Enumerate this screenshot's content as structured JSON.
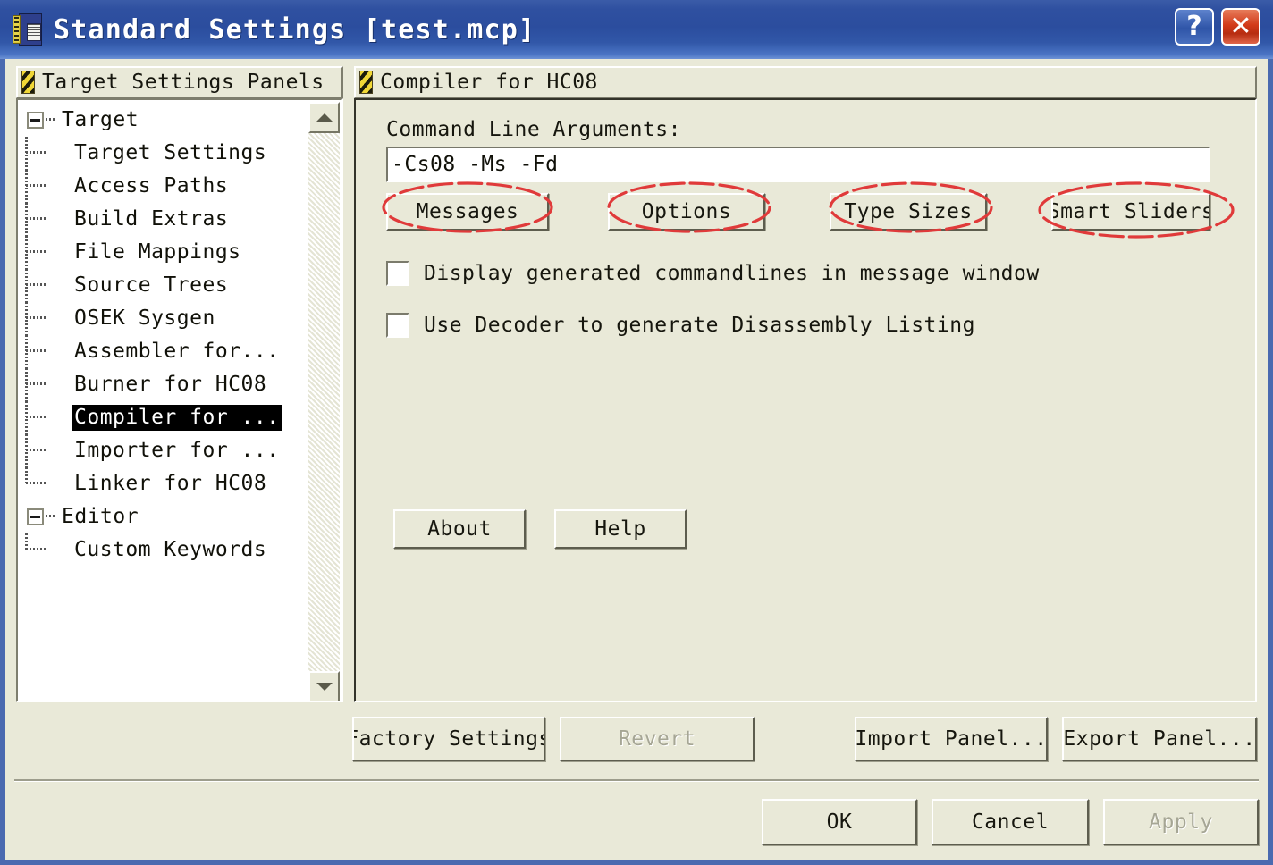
{
  "window": {
    "title": "Standard Settings [test.mcp]",
    "icon": "settings-document-icon",
    "help_button": "?",
    "close_button": "✕",
    "accent_color": "#2b4d9e",
    "face_color": "#e9e9d8"
  },
  "left_panel": {
    "header": "Target Settings Panels",
    "header_icon": "hazard-stripe-icon",
    "scrollbar": {
      "up_arrow": "scroll-up-arrow",
      "down_arrow": "scroll-down-arrow"
    },
    "tree": [
      {
        "label": "Target",
        "level": 0,
        "expander": "minus",
        "selected": false
      },
      {
        "label": "Target Settings",
        "level": 1,
        "expander": "none",
        "selected": false
      },
      {
        "label": "Access Paths",
        "level": 1,
        "expander": "none",
        "selected": false
      },
      {
        "label": "Build Extras",
        "level": 1,
        "expander": "none",
        "selected": false
      },
      {
        "label": "File Mappings",
        "level": 1,
        "expander": "none",
        "selected": false
      },
      {
        "label": "Source Trees",
        "level": 1,
        "expander": "none",
        "selected": false
      },
      {
        "label": "OSEK Sysgen",
        "level": 1,
        "expander": "none",
        "selected": false
      },
      {
        "label": "Assembler for...",
        "level": 1,
        "expander": "none",
        "selected": false
      },
      {
        "label": "Burner for HC08",
        "level": 1,
        "expander": "none",
        "selected": false
      },
      {
        "label": "Compiler for ...",
        "level": 1,
        "expander": "none",
        "selected": true
      },
      {
        "label": "Importer for ...",
        "level": 1,
        "expander": "none",
        "selected": false
      },
      {
        "label": "Linker for HC08",
        "level": 1,
        "expander": "none",
        "selected": false,
        "last": true
      },
      {
        "label": "Editor",
        "level": 0,
        "expander": "minus",
        "selected": false
      },
      {
        "label": "Custom Keywords",
        "level": 1,
        "expander": "none",
        "selected": false,
        "last": true
      }
    ]
  },
  "right_panel": {
    "header": "Compiler for HC08",
    "header_icon": "hazard-stripe-icon",
    "command_line": {
      "label": "Command Line Arguments:",
      "value": "-Cs08 -Ms -Fd",
      "placeholder": ""
    },
    "option_buttons": [
      {
        "label": "Messages",
        "annotated": true
      },
      {
        "label": "Options",
        "annotated": true
      },
      {
        "label": "Type Sizes",
        "annotated": true
      },
      {
        "label": "Smart Sliders",
        "annotated": true
      }
    ],
    "checkboxes": [
      {
        "label": "Display generated commandlines in message window",
        "checked": false
      },
      {
        "label": "Use Decoder to generate Disassembly Listing",
        "checked": false
      }
    ],
    "action_buttons": [
      {
        "label": "About",
        "enabled": true
      },
      {
        "label": "Help",
        "enabled": true
      }
    ]
  },
  "panel_buttons": [
    {
      "label": "Factory Settings",
      "enabled": true
    },
    {
      "label": "Revert",
      "enabled": false
    },
    {
      "label": "Import Panel...",
      "enabled": true
    },
    {
      "label": "Export Panel...",
      "enabled": true
    }
  ],
  "dialog_buttons": [
    {
      "label": "OK",
      "enabled": true
    },
    {
      "label": "Cancel",
      "enabled": true
    },
    {
      "label": "Apply",
      "enabled": false
    }
  ],
  "annotations": {
    "color": "#e03a3a",
    "shape": "hand-drawn-ellipse",
    "count": 4
  }
}
